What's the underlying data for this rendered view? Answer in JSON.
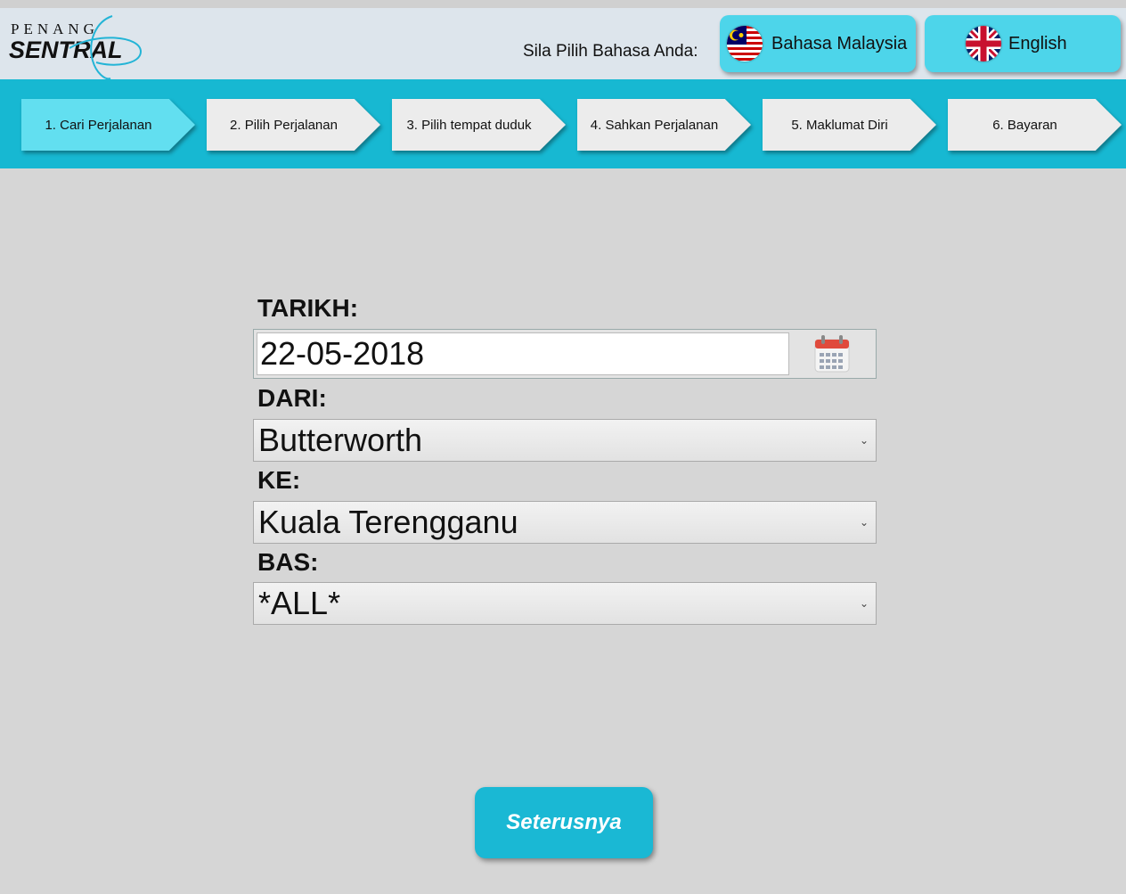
{
  "header": {
    "logo": {
      "top": "PENANG",
      "main": "SENTRAL"
    },
    "language_prompt": "Sila Pilih Bahasa Anda:",
    "languages": [
      {
        "label": "Bahasa Malaysia",
        "flag": "malaysia-flag-icon"
      },
      {
        "label": "English",
        "flag": "uk-flag-icon"
      }
    ]
  },
  "steps": [
    {
      "label": "1. Cari Perjalanan",
      "active": true
    },
    {
      "label": "2. Pilih Perjalanan",
      "active": false
    },
    {
      "label": "3. Pilih tempat duduk",
      "active": false
    },
    {
      "label": "4. Sahkan Perjalanan",
      "active": false
    },
    {
      "label": "5. Maklumat Diri",
      "active": false
    },
    {
      "label": "6. Bayaran",
      "active": false
    }
  ],
  "form": {
    "date": {
      "label": "TARIKH:",
      "value": "22-05-2018",
      "icon": "calendar-icon"
    },
    "from": {
      "label": "DARI:",
      "value": "Butterworth"
    },
    "to": {
      "label": "KE:",
      "value": "Kuala Terengganu"
    },
    "bus": {
      "label": "BAS:",
      "value": "*ALL*"
    }
  },
  "next_button": "Seterusnya",
  "colors": {
    "accent": "#17b8d2",
    "active_step": "#62dff0",
    "lang_button": "#4dd5ea"
  }
}
